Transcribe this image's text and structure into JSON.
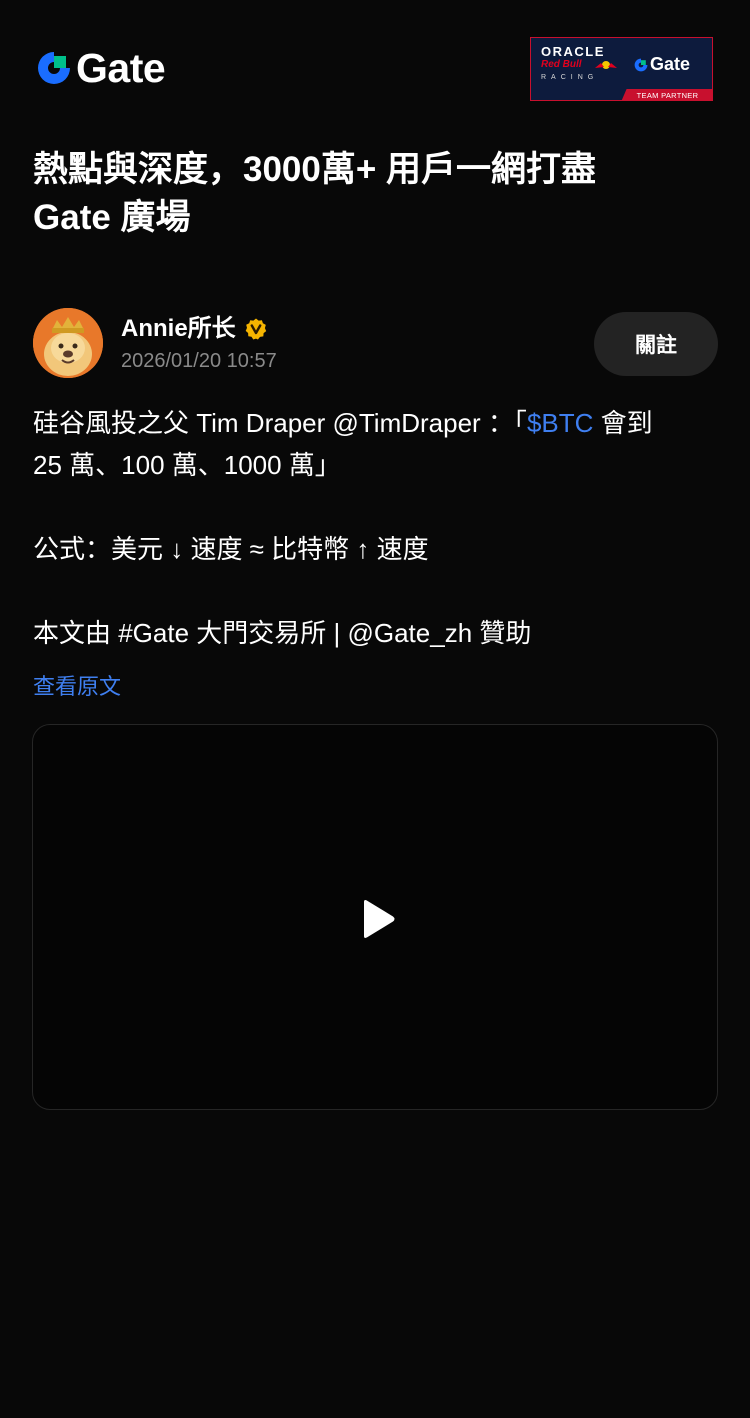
{
  "header": {
    "brand_name": "Gate",
    "partner_badge": {
      "oracle": "ORACLE",
      "red_bull": "Red Bull",
      "racing": "RACING",
      "brand": "Gate",
      "caption": "TEAM PARTNER"
    }
  },
  "headline": {
    "line1": "熱點與深度，3000萬+ 用戶一網打盡",
    "line2": "Gate 廣場"
  },
  "author": {
    "name": "Annie所长",
    "timestamp": "2026/01/20 10:57",
    "follow_label": "關註"
  },
  "post": {
    "line1_prefix": "硅谷風投之父 Tim Draper @TimDraper ：「",
    "ticker": "$BTC",
    "line1_suffix": " 會到",
    "line2": "25 萬、100 萬、1000 萬」",
    "line3": "公式：美元 ↓ 速度 ≈ 比特幣 ↑ 速度",
    "line4": "本文由 #Gate 大門交易所 | @Gate_zh 贊助",
    "view_original_label": "查看原文"
  },
  "colors": {
    "background": "#080808",
    "link": "#3f7ff0",
    "brand_blue": "#1a6dff",
    "brand_green": "#00c08b",
    "verified_gold": "#f5b400",
    "muted_text": "#8a8a8a"
  },
  "icons": {
    "brand_logo": "gate-logo-icon",
    "verified": "verified-badge-icon",
    "play": "play-icon"
  }
}
